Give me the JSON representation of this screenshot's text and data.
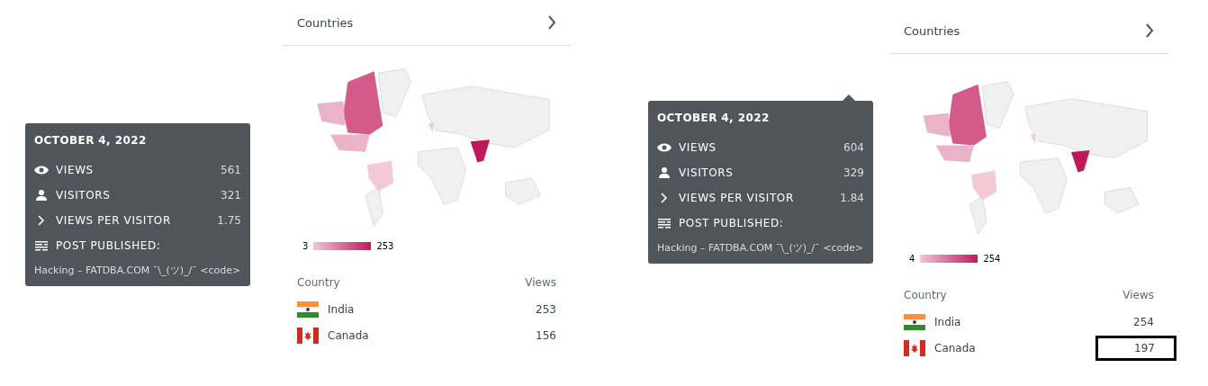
{
  "screens": [
    {
      "tooltip": {
        "date": "OCTOBER 4, 2022",
        "stats": [
          {
            "label": "VIEWS",
            "value": "561"
          },
          {
            "label": "VISITORS",
            "value": "321"
          },
          {
            "label": "VIEWS PER VISITOR",
            "value": "1.75"
          },
          {
            "label": "POST PUBLISHED:"
          }
        ],
        "post": "Hacking – FATDBA.COM ¯\\_(ツ)_/¯ <code>"
      },
      "panel": {
        "title": "Countries",
        "legend": {
          "min": "3",
          "max": "253"
        },
        "columns": [
          "Country",
          "Views"
        ],
        "rows": [
          {
            "country": "India",
            "views": "253",
            "highlighted": false
          },
          {
            "country": "Canada",
            "views": "156",
            "highlighted": false
          }
        ]
      }
    },
    {
      "tooltip": {
        "date": "OCTOBER 4, 2022",
        "stats": [
          {
            "label": "VIEWS",
            "value": "604"
          },
          {
            "label": "VISITORS",
            "value": "329"
          },
          {
            "label": "VIEWS PER VISITOR",
            "value": "1.84"
          },
          {
            "label": "POST PUBLISHED:"
          }
        ],
        "post": "Hacking – FATDBA.COM ¯\\_(ツ)_/¯ <code>"
      },
      "panel": {
        "title": "Countries",
        "legend": {
          "min": "4",
          "max": "254"
        },
        "columns": [
          "Country",
          "Views"
        ],
        "rows": [
          {
            "country": "India",
            "views": "254",
            "highlighted": false
          },
          {
            "country": "Canada",
            "views": "197",
            "highlighted": true
          }
        ]
      }
    }
  ]
}
